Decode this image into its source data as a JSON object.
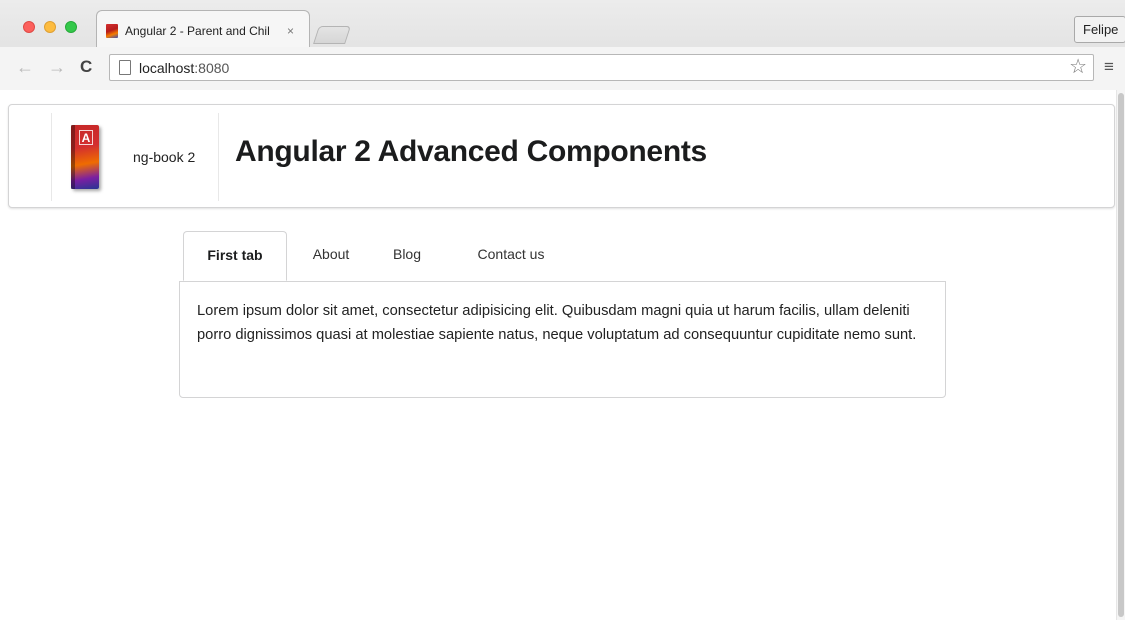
{
  "browser": {
    "tab_title": "Angular 2 - Parent and Chil",
    "tab_close": "×",
    "profile_name": "Felipe",
    "url_host": "localhost",
    "url_port": ":8080",
    "icons": {
      "back": "arrow-left-icon",
      "forward": "arrow-right-icon",
      "reload": "reload-icon",
      "page": "page-icon",
      "bookmark": "star-icon",
      "menu": "hamburger-menu-icon"
    }
  },
  "header": {
    "brand_name": "ng-book 2",
    "title": "Angular 2 Advanced Components"
  },
  "tabs": [
    {
      "label": "First tab",
      "active": true
    },
    {
      "label": "About",
      "active": false
    },
    {
      "label": "Blog",
      "active": false
    },
    {
      "label": "Contact us",
      "active": false
    }
  ],
  "content": {
    "text": "Lorem ipsum dolor sit amet, consectetur adipisicing elit. Quibusdam magni quia ut harum facilis, ullam deleniti porro dignissimos quasi at molestiae sapiente natus, neque voluptatum ad consequuntur cupiditate nemo sunt."
  },
  "colors": {
    "close": "#fc605c",
    "minimize": "#fdbc40",
    "zoom": "#34c84a",
    "title_text": "#1b1c1d",
    "border": "#d4d4d5"
  }
}
